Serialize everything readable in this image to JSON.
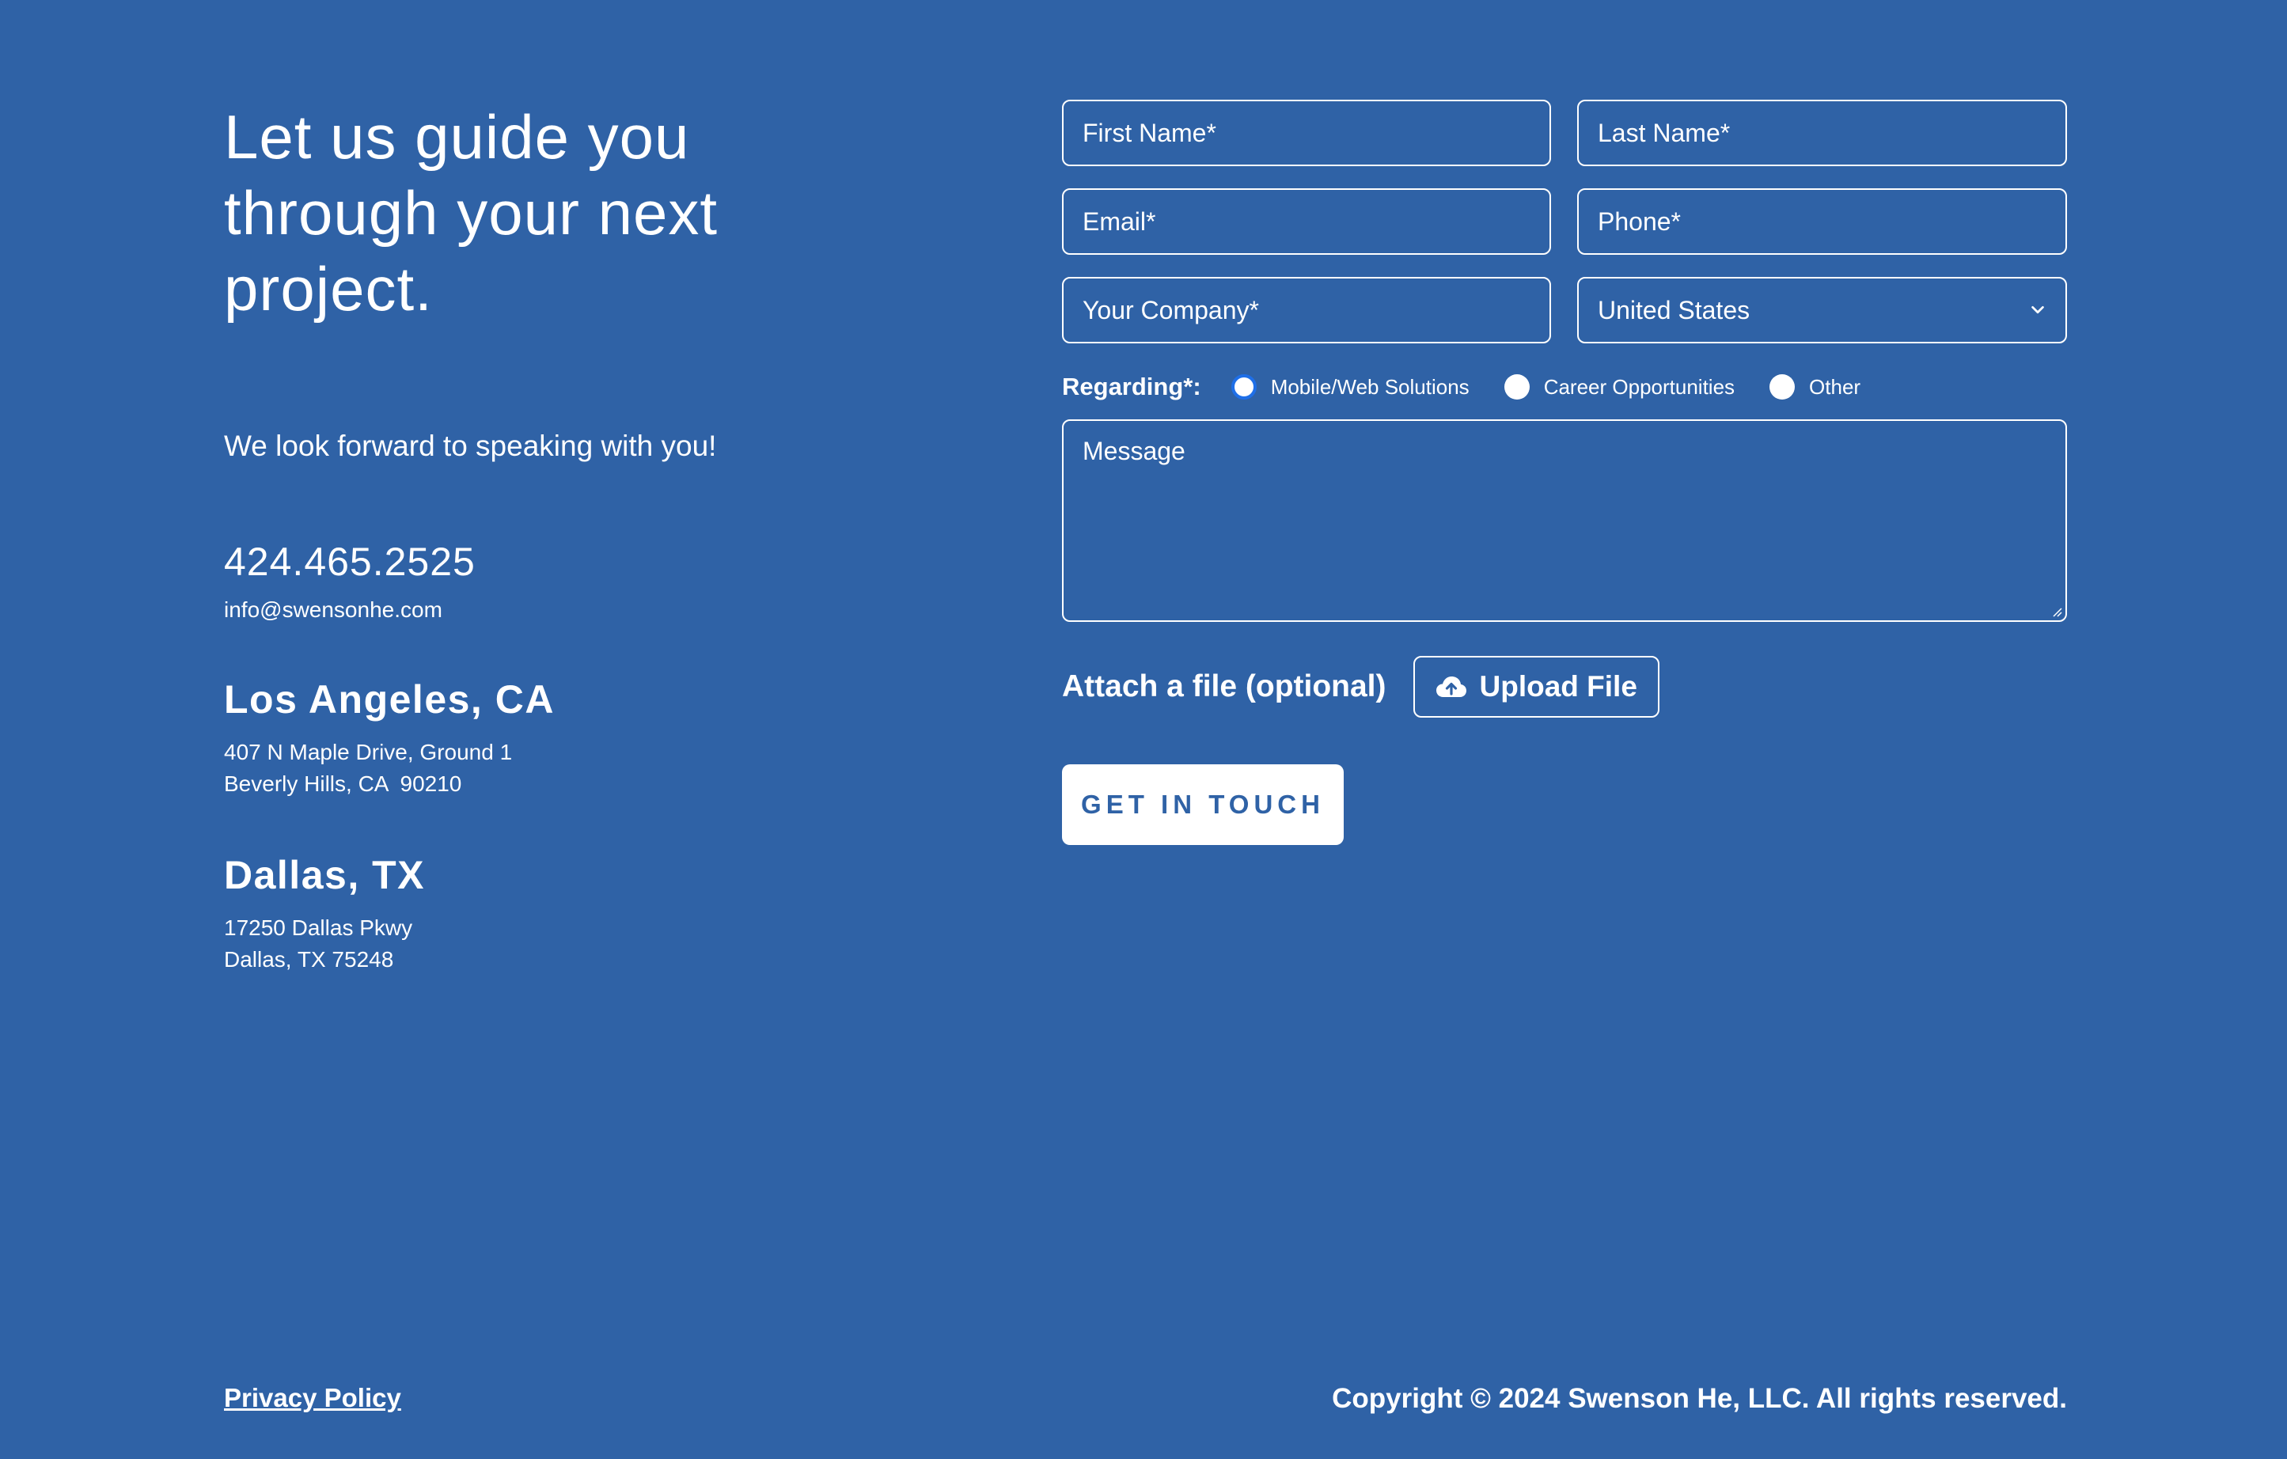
{
  "intro": {
    "headline": "Let us guide you through your next project.",
    "tagline": "We look forward to speaking with you!",
    "phone": "424.465.2525",
    "email": "info@swensonhe.com"
  },
  "offices": [
    {
      "city": "Los Angeles, CA",
      "line1": "407 N Maple Drive, Ground 1",
      "line2": "Beverly Hills, CA  90210"
    },
    {
      "city": "Dallas, TX",
      "line1": "17250 Dallas Pkwy",
      "line2": "Dallas, TX 75248"
    }
  ],
  "form": {
    "first_name_placeholder": "First Name*",
    "last_name_placeholder": "Last Name*",
    "email_placeholder": "Email*",
    "phone_placeholder": "Phone*",
    "company_placeholder": "Your Company*",
    "country_value": "United States",
    "regarding_label": "Regarding*:",
    "regarding_options": [
      {
        "label": "Mobile/Web Solutions",
        "checked": true
      },
      {
        "label": "Career Opportunities",
        "checked": false
      },
      {
        "label": "Other",
        "checked": false
      }
    ],
    "message_placeholder": "Message",
    "attach_label": "Attach a file (optional)",
    "upload_label": "Upload File",
    "submit_label": "GET IN TOUCH"
  },
  "footer": {
    "privacy_label": "Privacy Policy",
    "copyright": "Copyright © 2024 Swenson He, LLC. All rights reserved."
  },
  "colors": {
    "background": "#2f62a6",
    "text": "#ffffff",
    "radio_accent": "#1e6fe8"
  },
  "icons": {
    "upload": "cloud-upload-icon",
    "select": "chevron-down-icon"
  }
}
